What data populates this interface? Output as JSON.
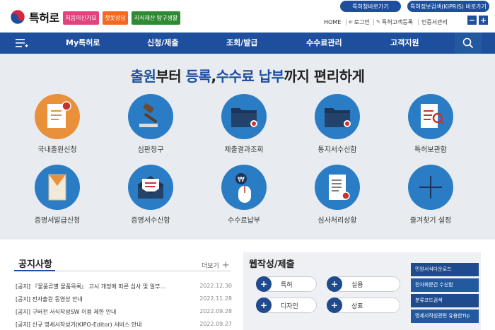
{
  "header": {
    "logo_text": "특허로",
    "pills": [
      "처음이신가요",
      "챗봇상담",
      "지식재산 탐구생활"
    ],
    "top_buttons": [
      "특허청바로가기",
      "특허정보검색(KIPRIS) 바로가기"
    ],
    "util_links": [
      "HOME",
      "로그인",
      "특허고객등록",
      "인증서관리"
    ],
    "font_minus": "−",
    "font_plus": "+"
  },
  "nav": {
    "items": [
      "My특허로",
      "신청/제출",
      "조회/발급",
      "수수료관리",
      "고객지원"
    ]
  },
  "hero": {
    "headline_parts": [
      "출원",
      "부터 ",
      "등록",
      ",",
      "수수료 납부",
      "까지 편리하게"
    ],
    "services": [
      {
        "label": "국내출원신청",
        "icon": "document-badge-icon",
        "color": "orange"
      },
      {
        "label": "심판청구",
        "icon": "gavel-icon",
        "color": "blue"
      },
      {
        "label": "제출결과조회",
        "icon": "folder-badge-icon",
        "color": "blue"
      },
      {
        "label": "통지서수신함",
        "icon": "folder-badge-icon",
        "color": "blue"
      },
      {
        "label": "특허보관함",
        "icon": "document-search-icon",
        "color": "blue"
      },
      {
        "label": "증명서발급신청",
        "icon": "envelope-certificate-icon",
        "color": "blue"
      },
      {
        "label": "증명서수신함",
        "icon": "mail-open-icon",
        "color": "blue"
      },
      {
        "label": "수수료납부",
        "icon": "mouse-won-icon",
        "color": "blue"
      },
      {
        "label": "심사처리상황",
        "icon": "scroll-badge-icon",
        "color": "blue"
      },
      {
        "label": "즐겨찾기 설정",
        "icon": "plus-icon",
        "color": "blue"
      }
    ]
  },
  "notices": {
    "title": "공지사항",
    "more": "더보기",
    "items": [
      {
        "text": "[공지] 『물품류별 물품목록』 고시 개정에 따른 심사 및 일부...",
        "date": "2022.12.30"
      },
      {
        "text": "[공지] 전자출원 동영상 안내",
        "date": "2022.11.28"
      },
      {
        "text": "[공지] 구버전 서식작성SW 이용 제한 안내",
        "date": "2022.09.28"
      },
      {
        "text": "[공지] 신규 명세서작성기(KIPO-Editor) 서비스 안내",
        "date": "2022.09.27"
      }
    ]
  },
  "write": {
    "title": "웹작성/제출",
    "buttons": [
      "특허",
      "실용",
      "디자인",
      "상표"
    ],
    "plus": "+",
    "side_links": [
      "민원서식다운로드",
      "전자화문건 수신함",
      "분류코드검색",
      "명세서작성관련 유용한Tip"
    ]
  },
  "colors": {
    "primary": "#1d4f9d",
    "accent_orange": "#e9903b",
    "service_blue": "#2a7dc4"
  }
}
